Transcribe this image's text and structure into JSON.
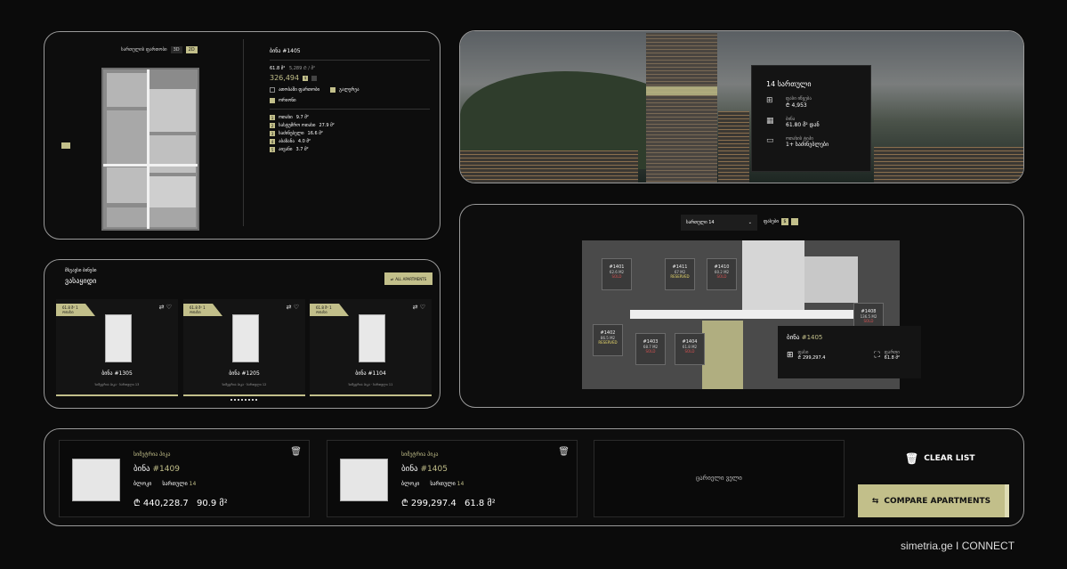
{
  "plan_panel": {
    "toggle_label": "სართულის ფართობი",
    "toggle_off": "3D",
    "toggle_on": "2D",
    "flat_title_prefix": "ბინა",
    "flat_title_number": "#1405",
    "area_text": "61.8 მ²",
    "price_per_sqm_text": "5,289 ₾ / მ²",
    "price": "326,494",
    "currency_button": "$",
    "check_1": "ათობაში ფართობი",
    "check_2": "გალერეა",
    "check_3": "ორიონი",
    "rooms": [
      {
        "num": "1",
        "label": "ოთახი",
        "value": "9.7 მ²"
      },
      {
        "num": "2",
        "label": "სასტუმრო ოთახი",
        "value": "27.9 მ²"
      },
      {
        "num": "3",
        "label": "საძინებელი",
        "value": "16.6 მ²"
      },
      {
        "num": "4",
        "label": "აბაზანა",
        "value": "4.0 მ²"
      },
      {
        "num": "5",
        "label": "აივანი",
        "value": "3.7 მ²"
      }
    ]
  },
  "building_panel": {
    "floor_title": "14 სართული",
    "row1_label": "ფასი იწყება",
    "row1_value": "₾ 4,953",
    "row2_label": "ბინა",
    "row2_value": "61.80 მ² დან",
    "row3_label": "ოთახის ტიპი",
    "row3_value": "1+ საძინებლები"
  },
  "similar_panel": {
    "eyebrow": "მსგავსი ბინები",
    "title": "ვასაყიდი",
    "all_button": "ALL APARTMENTS",
    "cards": [
      {
        "tag": "61.8 მ²",
        "tag_sub": "1 ოთახი",
        "name": "ბინა #1305",
        "sub": "სიმეტრია პიკა · სართული 13"
      },
      {
        "tag": "61.8 მ²",
        "tag_sub": "1 ოთახი",
        "name": "ბინა #1205",
        "sub": "სიმეტრია პიკა · სართული 12"
      },
      {
        "tag": "61.8 მ²",
        "tag_sub": "1 ოთახი",
        "name": "ბინა #1104",
        "sub": "სიმეტრია პიკა · სართული 11"
      }
    ]
  },
  "floor_panel": {
    "floor_select": "სართული 14",
    "switch_label": "ფასები",
    "switch_button": "$",
    "units": [
      {
        "id": "#1401",
        "area": "62.6 M2",
        "status": "",
        "red": "SOLD"
      },
      {
        "id": "#1411",
        "area": "67 M2",
        "status": "RESERVED",
        "red": ""
      },
      {
        "id": "#1410",
        "area": "60.2 M2",
        "status": "",
        "red": "SOLD"
      },
      {
        "id": "#1402",
        "area": "86.5 M2",
        "status": "RESERVED",
        "red": ""
      },
      {
        "id": "#1403",
        "area": "68.7 M2",
        "status": "",
        "red": "SOLD"
      },
      {
        "id": "#1404",
        "area": "61.8 M2",
        "status": "",
        "red": "SOLD"
      },
      {
        "id": "#1408",
        "area": "136.5 M2",
        "status": "",
        "red": "SOLD"
      }
    ],
    "popup_title_prefix": "ბინა",
    "popup_title_number": "#1405",
    "popup_price_label": "ფასი",
    "popup_price": "₾ 299,297.4",
    "popup_area_label": "ფართი",
    "popup_area": "61.8 მ²"
  },
  "compare": {
    "items": [
      {
        "project": "სიმეტრია პიკა",
        "prefix": "ბინა",
        "number": "#1409",
        "block_label": "ბლოკი",
        "floor_label": "სართული",
        "floor": "14",
        "price": "₾ 440,228.7",
        "area": "90.9 მ²"
      },
      {
        "project": "სიმეტრია პიკა",
        "prefix": "ბინა",
        "number": "#1405",
        "block_label": "ბლოკი",
        "floor_label": "სართული",
        "floor": "14",
        "price": "₾ 299,297.4",
        "area": "61.8 მ²"
      }
    ],
    "empty_text": "ცარიელი ველი",
    "clear_label": "CLEAR LIST",
    "compare_label": "COMPARE APARTMENTS"
  },
  "footer": "simetria.ge I CONNECT",
  "colors": {
    "accent": "#c2bf8a",
    "background": "#0b0b0b"
  }
}
